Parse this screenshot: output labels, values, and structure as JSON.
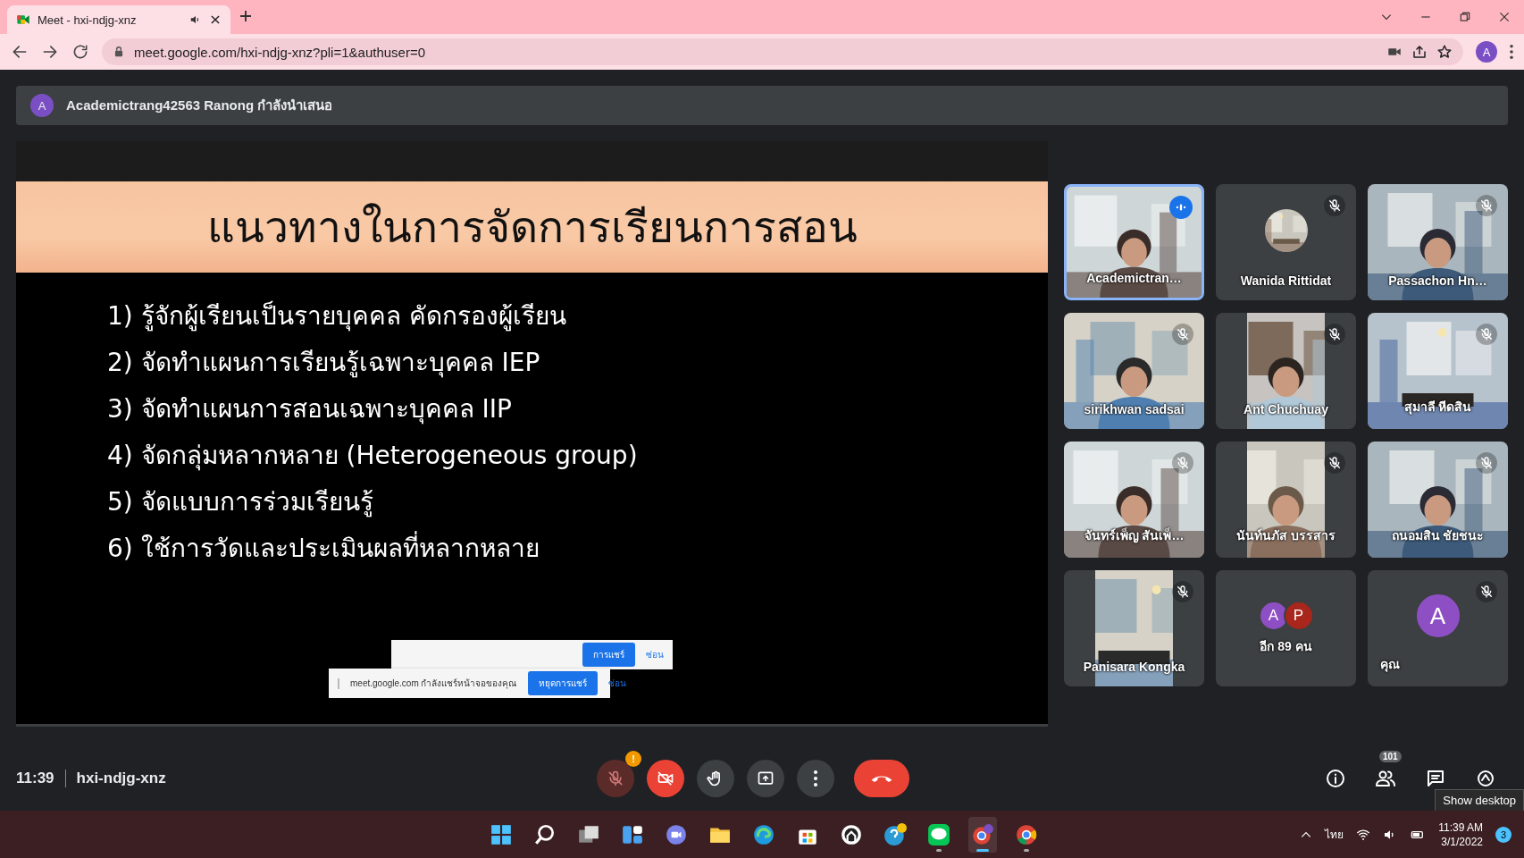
{
  "browser": {
    "tab": {
      "title": "Meet - hxi-ndjg-xnz",
      "audio": true,
      "selected": true
    },
    "url": "meet.google.com/hxi-ndjg-xnz?pli=1&authuser=0",
    "profile": "A"
  },
  "presenter": {
    "avatar": "A",
    "text": "Academictrang42563 Ranong กำลังนำเสนอ"
  },
  "slide": {
    "title": "แนวทางในการจัดการเรียนการสอน",
    "items": [
      "1) รู้จักผู้เรียนเป็นรายบุคคล คัดกรองผู้เรียน",
      "2) จัดทำแผนการเรียนรู้เฉพาะบุคคล IEP",
      "3) จัดทำแผนการสอนเฉพาะบุคคล IIP",
      "4) จัดกลุ่มหลากหลาย (Heterogeneous group)",
      "5) จัดแบบการร่วมเรียนรู้",
      "6) ใช้การวัดและประเมินผลที่หลากหลาย"
    ]
  },
  "share_banners": [
    {
      "button": "การแชร์",
      "hide": "ซ่อน"
    },
    {
      "message": "meet.google.com กำลังแชร์หน้าจอของคุณ",
      "button": "หยุดการแชร์",
      "hide": "ซ่อน"
    }
  ],
  "tiles": [
    {
      "kind": "video",
      "name": "Academictran…",
      "speaking": true,
      "muted": false
    },
    {
      "kind": "photo-avatar",
      "name": "Wanida Rittidat",
      "speaking": false,
      "muted": true
    },
    {
      "kind": "video",
      "name": "Passachon Hn…",
      "speaking": false,
      "muted": true
    },
    {
      "kind": "video",
      "name": "sirikhwan sadsai",
      "speaking": false,
      "muted": true
    },
    {
      "kind": "video-portrait",
      "name": "Ant Chuchuay",
      "speaking": false,
      "muted": true
    },
    {
      "kind": "video",
      "name": "สุมาลี หีดสิน",
      "speaking": false,
      "muted": true
    },
    {
      "kind": "video",
      "name": "จันทร์เพ็ญ สันเพ็…",
      "speaking": false,
      "muted": true
    },
    {
      "kind": "video-portrait",
      "name": "นันท์นภัส บรรสาร",
      "speaking": false,
      "muted": true
    },
    {
      "kind": "video",
      "name": "ถนอมสิน ชัยชนะ",
      "speaking": false,
      "muted": true
    },
    {
      "kind": "video-portrait",
      "name": "Panisara Kongka",
      "speaking": false,
      "muted": true
    },
    {
      "kind": "others",
      "name": "อีก 89 คน",
      "speaking": false,
      "muted": false,
      "avatars": [
        {
          "letter": "A",
          "color": "#8e4fc4"
        },
        {
          "letter": "P",
          "color": "#a8261b"
        }
      ]
    },
    {
      "kind": "self",
      "name": "คุณ",
      "speaking": false,
      "muted": true,
      "avatars": [
        {
          "letter": "A",
          "color": "#8e4fc4"
        }
      ]
    }
  ],
  "call_bar": {
    "time": "11:39",
    "meeting_code": "hxi-ndjg-xnz",
    "controls": [
      {
        "kind": "mic",
        "on": false,
        "alert": "!"
      },
      {
        "kind": "camera",
        "on": false
      },
      {
        "kind": "hand"
      },
      {
        "kind": "present"
      },
      {
        "kind": "more"
      },
      {
        "kind": "leave"
      }
    ],
    "side": [
      {
        "kind": "info"
      },
      {
        "kind": "people",
        "badge": "101"
      },
      {
        "kind": "chat"
      },
      {
        "kind": "activities"
      }
    ],
    "tooltip": "Show desktop"
  },
  "taskbar": {
    "apps": [
      {
        "kind": "start",
        "running": false,
        "active": false
      },
      {
        "kind": "search",
        "running": false,
        "active": false
      },
      {
        "kind": "taskview",
        "running": false,
        "active": false
      },
      {
        "kind": "widgets",
        "running": false,
        "active": false
      },
      {
        "kind": "chat",
        "running": false,
        "active": false
      },
      {
        "kind": "explorer",
        "running": false,
        "active": false
      },
      {
        "kind": "edge",
        "running": false,
        "active": false
      },
      {
        "kind": "store",
        "running": false,
        "active": false
      },
      {
        "kind": "ring",
        "running": false,
        "active": false
      },
      {
        "kind": "help",
        "running": false,
        "active": false
      },
      {
        "kind": "messenger",
        "running": true,
        "active": false
      },
      {
        "kind": "browser-profile",
        "running": true,
        "active": true
      },
      {
        "kind": "browser",
        "running": true,
        "active": false
      }
    ],
    "language": "ไทย",
    "time": "11:39 AM",
    "date": "3/1/2022",
    "notifications": "3"
  }
}
